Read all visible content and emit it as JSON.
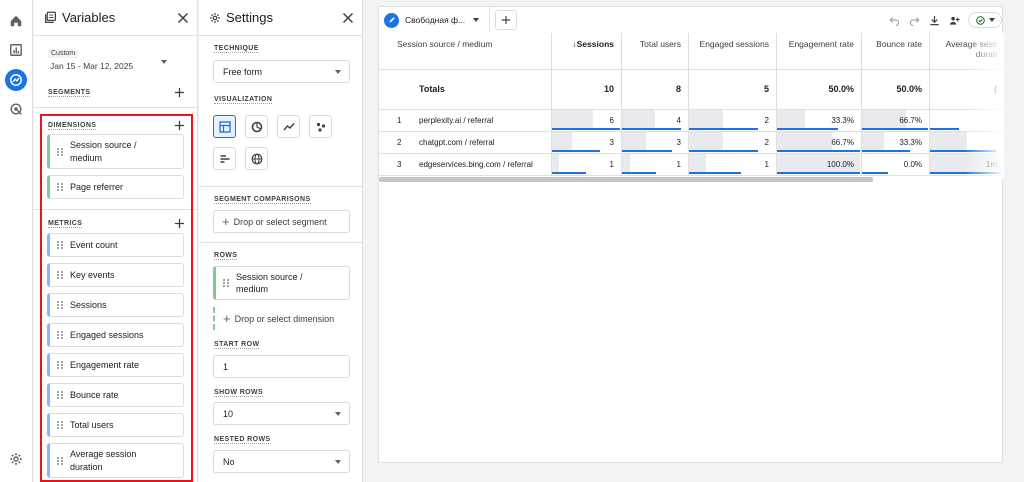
{
  "variables_panel": {
    "title": "Variables",
    "date": {
      "tag": "Custom",
      "range": "Jan 15 - Mar 12, 2025"
    },
    "segments_label": "SEGMENTS",
    "dimensions_label": "DIMENSIONS",
    "dimensions": [
      {
        "line1": "Session source /",
        "line2": "medium"
      },
      {
        "line1": "Page referrer",
        "line2": ""
      }
    ],
    "metrics_label": "METRICS",
    "metrics": [
      {
        "line1": "Event count",
        "line2": ""
      },
      {
        "line1": "Key events",
        "line2": ""
      },
      {
        "line1": "Sessions",
        "line2": ""
      },
      {
        "line1": "Engaged sessions",
        "line2": ""
      },
      {
        "line1": "Engagement rate",
        "line2": ""
      },
      {
        "line1": "Bounce rate",
        "line2": ""
      },
      {
        "line1": "Total users",
        "line2": ""
      },
      {
        "line1": "Average session",
        "line2": "duration"
      }
    ]
  },
  "settings_panel": {
    "title": "Settings",
    "technique_label": "TECHNIQUE",
    "technique_value": "Free form",
    "visualization_label": "VISUALIZATION",
    "segment_comparisons_label": "SEGMENT COMPARISONS",
    "segment_drop": "Drop or select segment",
    "rows_label": "ROWS",
    "row_dimension": {
      "line1": "Session source /",
      "line2": "medium"
    },
    "dimension_drop": "Drop or select dimension",
    "start_row_label": "START ROW",
    "start_row_value": "1",
    "show_rows_label": "SHOW ROWS",
    "show_rows_value": "10",
    "nested_rows_label": "NESTED ROWS",
    "nested_rows_value": "No"
  },
  "canvas": {
    "tab_label": "Свободная ф...",
    "columns": [
      {
        "label": "Session source / medium",
        "sub": ""
      },
      {
        "label": "↓Sessions",
        "sub": ""
      },
      {
        "label": "Total users",
        "sub": ""
      },
      {
        "label": "Engaged sessions",
        "sub": ""
      },
      {
        "label": "Engagement rate",
        "sub": ""
      },
      {
        "label": "Bounce rate",
        "sub": ""
      },
      {
        "label": "Average sess",
        "sub": "durati"
      }
    ],
    "totals": {
      "label": "Totals",
      "values": [
        "10",
        "8",
        "5",
        "50.0%",
        "50.0%",
        "("
      ]
    },
    "rows": [
      {
        "index": "1",
        "name": "perplexity.ai / referral",
        "values": [
          "6",
          "4",
          "2",
          "33.3%",
          "66.7%",
          ""
        ]
      },
      {
        "index": "2",
        "name": "chatgpt.com / referral",
        "values": [
          "3",
          "3",
          "2",
          "66.7%",
          "33.3%",
          ""
        ]
      },
      {
        "index": "3",
        "name": "edgeservices.bing.com / referral",
        "values": [
          "1",
          "1",
          "1",
          "100.0%",
          "0.0%",
          "1m"
        ]
      }
    ],
    "bar_fractions": [
      [
        0.6,
        0.5,
        0.4,
        0.333,
        0.667,
        0.0
      ],
      [
        0.3,
        0.375,
        0.4,
        0.667,
        0.333,
        0.5
      ],
      [
        0.1,
        0.125,
        0.2,
        1.0,
        0.0,
        1.0
      ]
    ]
  },
  "colors": {
    "accent": "#1a73e8",
    "dimension_chip": "#81c995",
    "metric_chip": "#8ab4f8",
    "highlight_box": "#e8141b",
    "status_ok": "#188038"
  }
}
